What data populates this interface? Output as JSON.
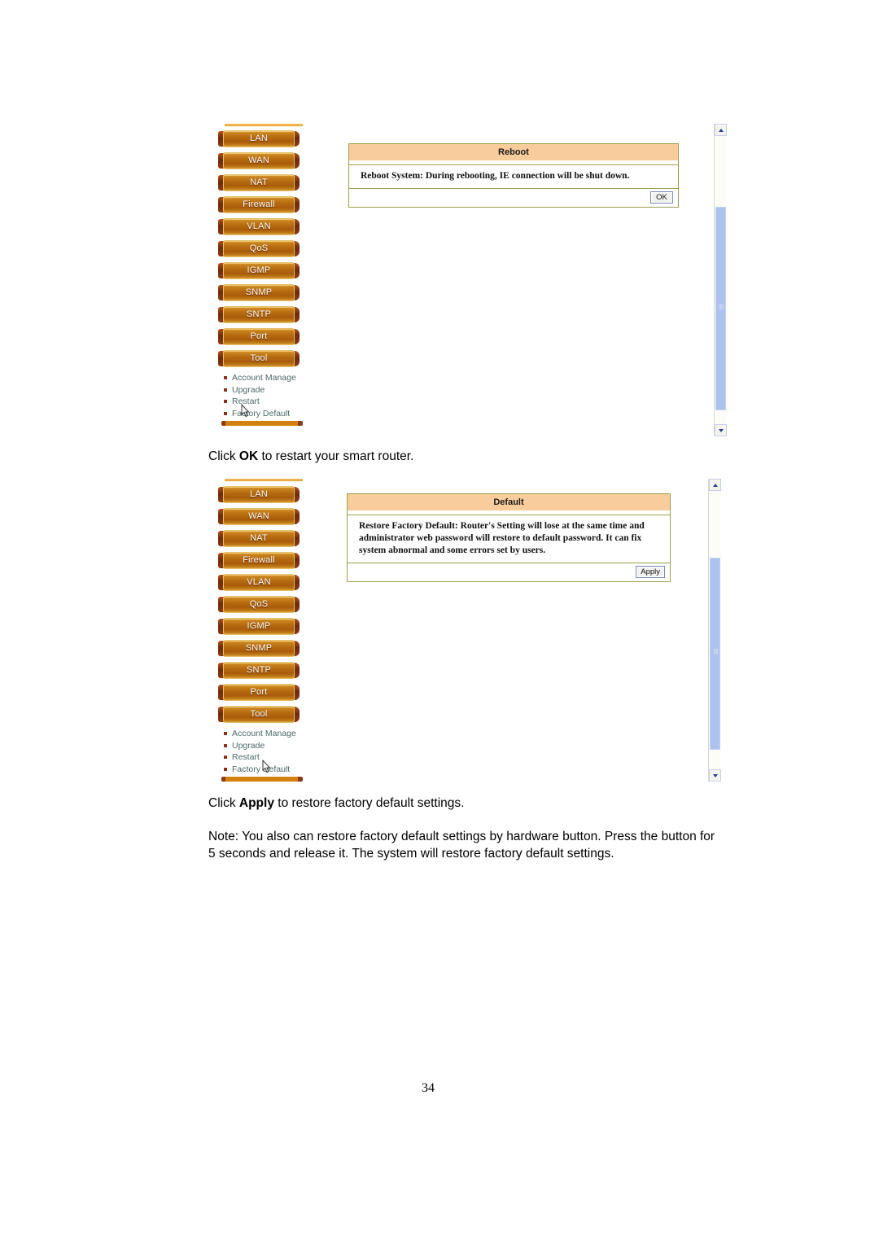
{
  "page": {
    "number": "34"
  },
  "screenshots": [
    {
      "name": "reboot-screenshot",
      "nav_items": [
        "LAN",
        "WAN",
        "NAT",
        "Firewall",
        "VLAN",
        "QoS",
        "IGMP",
        "SNMP",
        "SNTP",
        "Port",
        "Tool"
      ],
      "sub_items": [
        "Account Manage",
        "Upgrade",
        "Restart",
        "Factory Default"
      ],
      "panel": {
        "title": "Reboot",
        "body": "Reboot System: During rebooting, IE connection will be shut down.",
        "button": "OK"
      }
    },
    {
      "name": "default-screenshot",
      "nav_items": [
        "LAN",
        "WAN",
        "NAT",
        "Firewall",
        "VLAN",
        "QoS",
        "IGMP",
        "SNMP",
        "SNTP",
        "Port",
        "Tool"
      ],
      "sub_items": [
        "Account Manage",
        "Upgrade",
        "Restart",
        "Factory Default"
      ],
      "panel": {
        "title": "Default",
        "body": "Restore Factory Default: Router's Setting will lose at the same time and administrator web password will restore to default password. It can fix system abnormal and some errors set by users.",
        "button": "Apply"
      }
    }
  ],
  "captions": {
    "reboot_prefix": "Click ",
    "reboot_bold": "OK",
    "reboot_suffix": " to restart your smart router.",
    "default_prefix": "Click ",
    "default_bold": "Apply",
    "default_suffix": " to restore factory default settings.",
    "note_line1": "Note: You also can restore factory default settings by hardware button. Press the button for",
    "note_line2": "5 seconds and release it. The system will restore factory default settings."
  },
  "colors": {
    "panel_title_bg": "#f8cc9b",
    "panel_border": "#9aa04a",
    "nav_button": "#b5690f",
    "scrollbar_thumb": "#adc2ef"
  }
}
